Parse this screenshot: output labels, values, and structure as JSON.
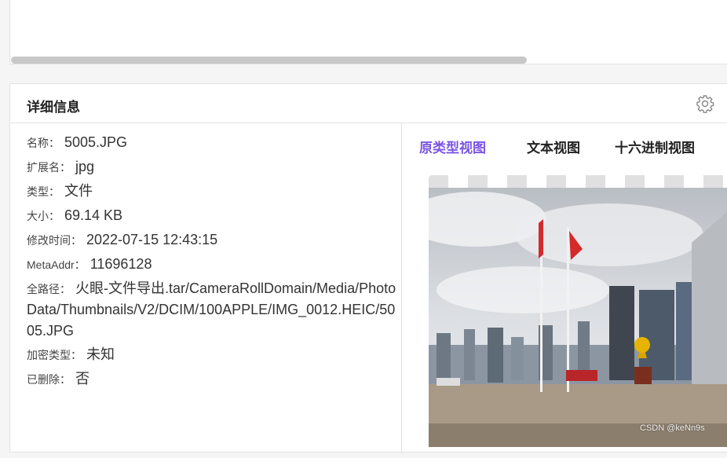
{
  "details": {
    "title": "详细信息",
    "rows": [
      {
        "label": "名称：",
        "value": "5005.JPG"
      },
      {
        "label": "扩展名：",
        "value": "jpg"
      },
      {
        "label": "类型：",
        "value": "文件"
      },
      {
        "label": "大小：",
        "value": "69.14 KB"
      },
      {
        "label": "修改时间：",
        "value": "2022-07-15 12:43:15"
      },
      {
        "label": "MetaAddr：",
        "value": "11696128"
      },
      {
        "label": "全路径：",
        "value": "火眼-文件导出.tar/CameraRollDomain/Media/PhotoData/Thumbnails/V2/DCIM/100APPLE/IMG_0012.HEIC/5005.JPG"
      },
      {
        "label": "加密类型：",
        "value": "未知"
      },
      {
        "label": "已删除：",
        "value": "否"
      }
    ]
  },
  "tabs": [
    {
      "label": "原类型视图",
      "active": true
    },
    {
      "label": "文本视图",
      "active": false
    },
    {
      "label": "十六进制视图",
      "active": false
    }
  ],
  "watermark": "CSDN @keNn9s",
  "colors": {
    "accent": "#7b56e5"
  }
}
